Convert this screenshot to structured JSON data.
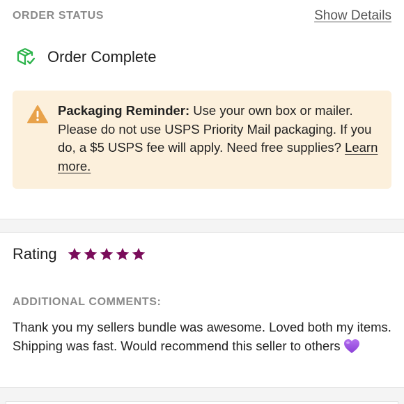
{
  "order_status": {
    "header": "ORDER STATUS",
    "show_details": "Show Details",
    "status_text": "Order Complete",
    "status_icon": "package-check-icon",
    "status_color": "#2bb34a"
  },
  "notice": {
    "icon": "warning-icon",
    "icon_color": "#e8a24a",
    "background": "#fcf0dc",
    "title": "Packaging Reminder:",
    "body": " Use your own box or mailer. Please do not use USPS Priority Mail packaging. If you do, a $5 USPS fee will apply. Need free supplies? ",
    "link": "Learn more."
  },
  "rating": {
    "label": "Rating",
    "stars": 5,
    "max_stars": 5,
    "star_color": "#7a0c5a"
  },
  "comments": {
    "header": "ADDITIONAL COMMENTS:",
    "text": "Thank you my sellers bundle was awesome. Loved both my items. Shipping was fast. Would recommend this seller to others",
    "emoji": "purple-heart-icon"
  }
}
